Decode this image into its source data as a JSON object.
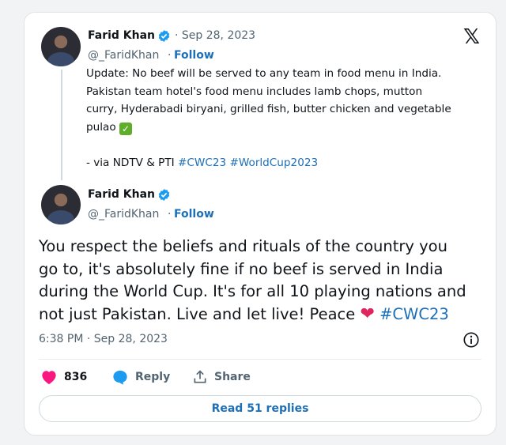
{
  "quoted": {
    "name": "Farid Khan",
    "date": "· Sep 28, 2023",
    "handle": "@_FaridKhan",
    "follow": "Follow",
    "line1": "Update: No beef will be served to any team in food menu in India.",
    "line2": "Pakistan team hotel's food menu includes lamb chops, mutton",
    "line3": "curry, Hyderabadi biryani, grilled fish, butter chicken and vegetable",
    "line4": "pulao",
    "via": "- via NDTV & PTI",
    "tags": "#CWC23 #WorldCup2023"
  },
  "main": {
    "name": "Farid Khan",
    "handle": "@_FaridKhan",
    "follow": "Follow",
    "text_l1": "You respect the beliefs and rituals of the country you",
    "text_l2": "go to, it's absolutely fine if no beef is served in India",
    "text_l3": "during the World Cup. It's for all 10 playing nations and",
    "text_l4": "not just Pakistan. Live and let live! Peace",
    "hashtag": "#CWC23",
    "timestamp": "6:38 PM · Sep 28, 2023"
  },
  "actions": {
    "likes": "836",
    "reply": "Reply",
    "share": "Share"
  },
  "read_replies": "Read 51 replies",
  "colors": {
    "link": "#1d6fb8",
    "heart": "#e0245e",
    "verified": "#1d9bf0"
  },
  "icons": [
    "x-logo-icon",
    "verified-icon",
    "heart-icon",
    "reply-icon",
    "share-icon",
    "info-icon",
    "check-emoji-icon"
  ]
}
